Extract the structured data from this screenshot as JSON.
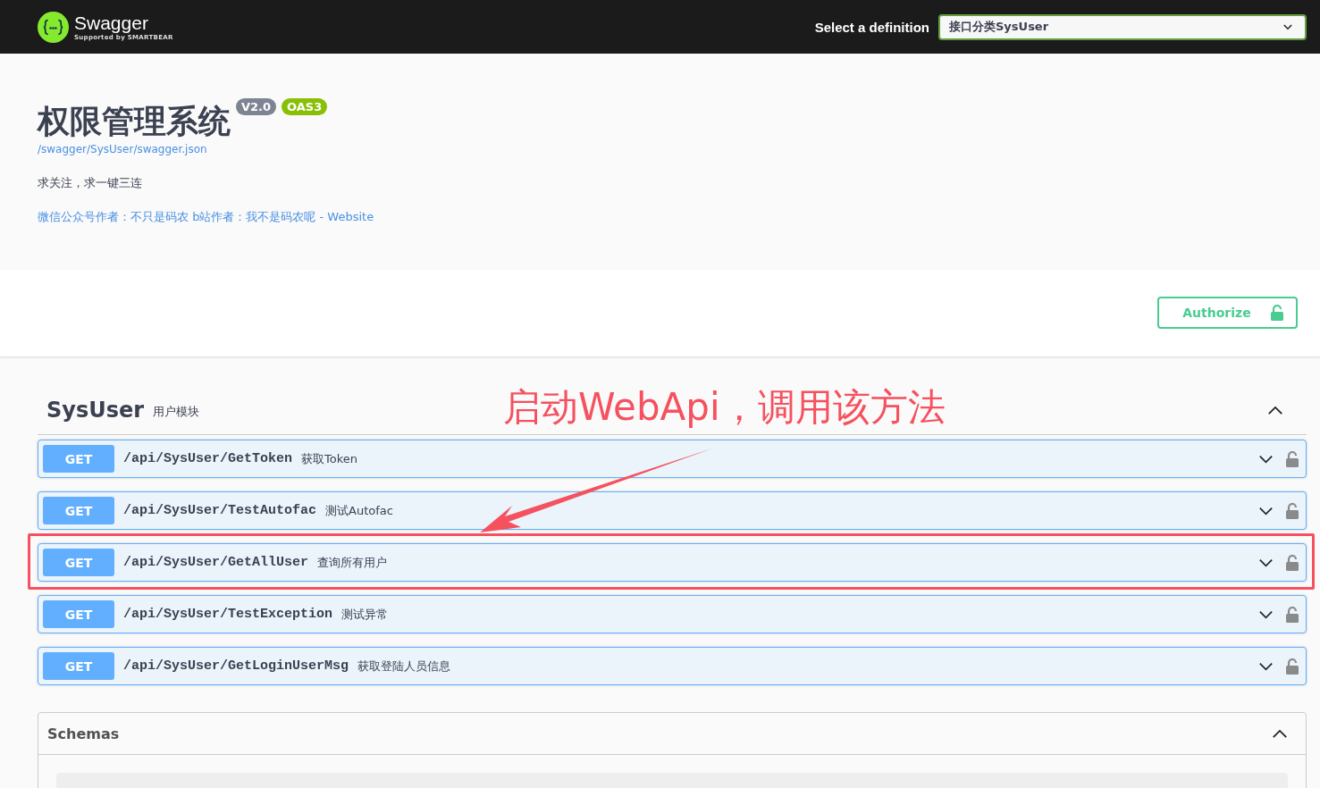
{
  "topbar": {
    "logo_title": "Swagger",
    "logo_subtitle": "Supported by SMARTBEAR",
    "select_label": "Select a definition",
    "select_value": "接口分类SysUser"
  },
  "info": {
    "title": "权限管理系统",
    "version": "V2.0",
    "spec": "OAS3",
    "url": "/swagger/SysUser/swagger.json",
    "description": "求关注，求一键三连",
    "contact_link": "微信公众号作者：不只是码农 b站作者：我不是码农呢 - Website"
  },
  "authorize": {
    "label": "Authorize"
  },
  "tag": {
    "name": "SysUser",
    "description": "用户模块",
    "expanded": true
  },
  "annotation": {
    "text": "启动WebApi，调用该方法"
  },
  "operations": [
    {
      "method": "GET",
      "path": "/api/SysUser/GetToken",
      "summary": "获取Token",
      "expanded": false,
      "highlighted": false
    },
    {
      "method": "GET",
      "path": "/api/SysUser/TestAutofac",
      "summary": "测试Autofac",
      "expanded": false,
      "highlighted": false
    },
    {
      "method": "GET",
      "path": "/api/SysUser/GetAllUser",
      "summary": "查询所有用户",
      "expanded": false,
      "highlighted": true
    },
    {
      "method": "GET",
      "path": "/api/SysUser/TestException",
      "summary": "测试异常",
      "expanded": false,
      "highlighted": false
    },
    {
      "method": "GET",
      "path": "/api/SysUser/GetLoginUserMsg",
      "summary": "获取登陆人员信息",
      "expanded": false,
      "highlighted": false
    }
  ],
  "schemas": {
    "title": "Schemas",
    "expanded": true
  }
}
